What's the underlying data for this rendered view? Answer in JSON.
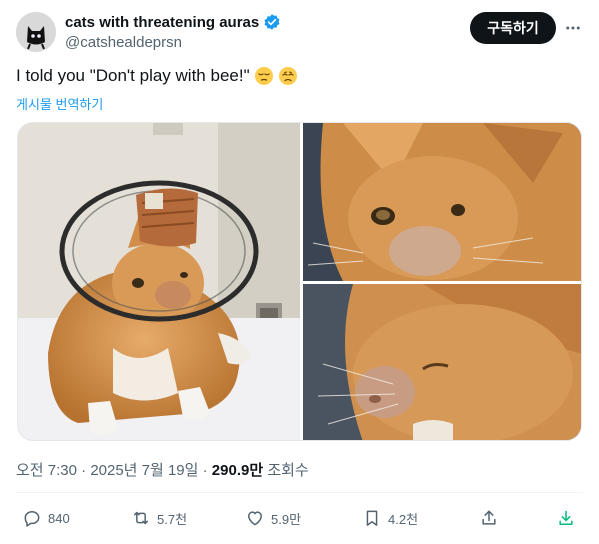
{
  "author": {
    "display_name": "cats with threatening auras",
    "handle": "@catshealdeprsn",
    "verified": true
  },
  "header": {
    "subscribe_label": "구독하기",
    "more_icon": "more-dots-icon"
  },
  "tweet": {
    "text": "I told you \"Don't play with bee!\"",
    "emojis": [
      "pensive-face-emoji",
      "disappointed-face-emoji"
    ],
    "translate_label": "게시물 번역하기"
  },
  "media": {
    "count": 3,
    "items": [
      "cat-in-cone-photo",
      "cat-swollen-face-closeup-photo",
      "cat-swollen-nose-closeup-photo"
    ]
  },
  "meta": {
    "time": "오전 7:30",
    "separator": "·",
    "date": "2025년 7월 19일",
    "views_count": "290.9만",
    "views_label": "조회수"
  },
  "actions": {
    "replies": "840",
    "reposts": "5.7천",
    "likes": "5.9만",
    "bookmarks": "4.2천"
  },
  "colors": {
    "accent": "#1d9bf0",
    "text_primary": "#0f1419",
    "text_secondary": "#536471",
    "button_bg": "#0f1419",
    "share_green": "#00ba7c"
  }
}
